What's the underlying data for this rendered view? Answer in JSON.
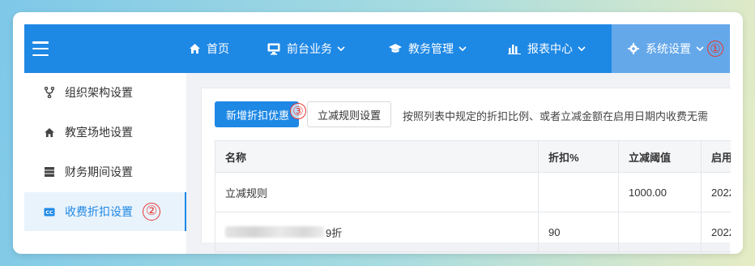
{
  "topnav": {
    "items": [
      {
        "label": "首页",
        "icon": "home-icon"
      },
      {
        "label": "前台业务",
        "icon": "monitor-icon",
        "has_dropdown": true
      },
      {
        "label": "教务管理",
        "icon": "graduation-cap-icon",
        "has_dropdown": true
      },
      {
        "label": "报表中心",
        "icon": "bar-chart-icon",
        "has_dropdown": true
      },
      {
        "label": "系统设置",
        "icon": "gear-icon",
        "has_dropdown": true,
        "active": true
      }
    ]
  },
  "annotations": {
    "marker1": "①",
    "marker2": "②",
    "marker3": "③"
  },
  "sidebar": {
    "items": [
      {
        "label": "组织架构设置",
        "icon": "org-structure-icon"
      },
      {
        "label": "教室场地设置",
        "icon": "home-icon"
      },
      {
        "label": "财务期间设置",
        "icon": "calendar-grid-icon"
      },
      {
        "label": "收费折扣设置",
        "icon": "cc-icon",
        "active": true
      }
    ]
  },
  "toolbar": {
    "add_label": "新增折扣优惠",
    "reduce_label": "立减规则设置",
    "hint": "按照列表中规定的折扣比例、或者立减金额在启用日期内收费无需"
  },
  "table": {
    "headers": [
      "名称",
      "折扣%",
      "立减阈值",
      "启用"
    ],
    "rows": [
      [
        "立减规则",
        "",
        "1000.00",
        "2022"
      ],
      [
        "9折",
        "90",
        "",
        "2022"
      ]
    ]
  },
  "colors": {
    "primary": "#1e88e5",
    "marker": "#e53935"
  }
}
